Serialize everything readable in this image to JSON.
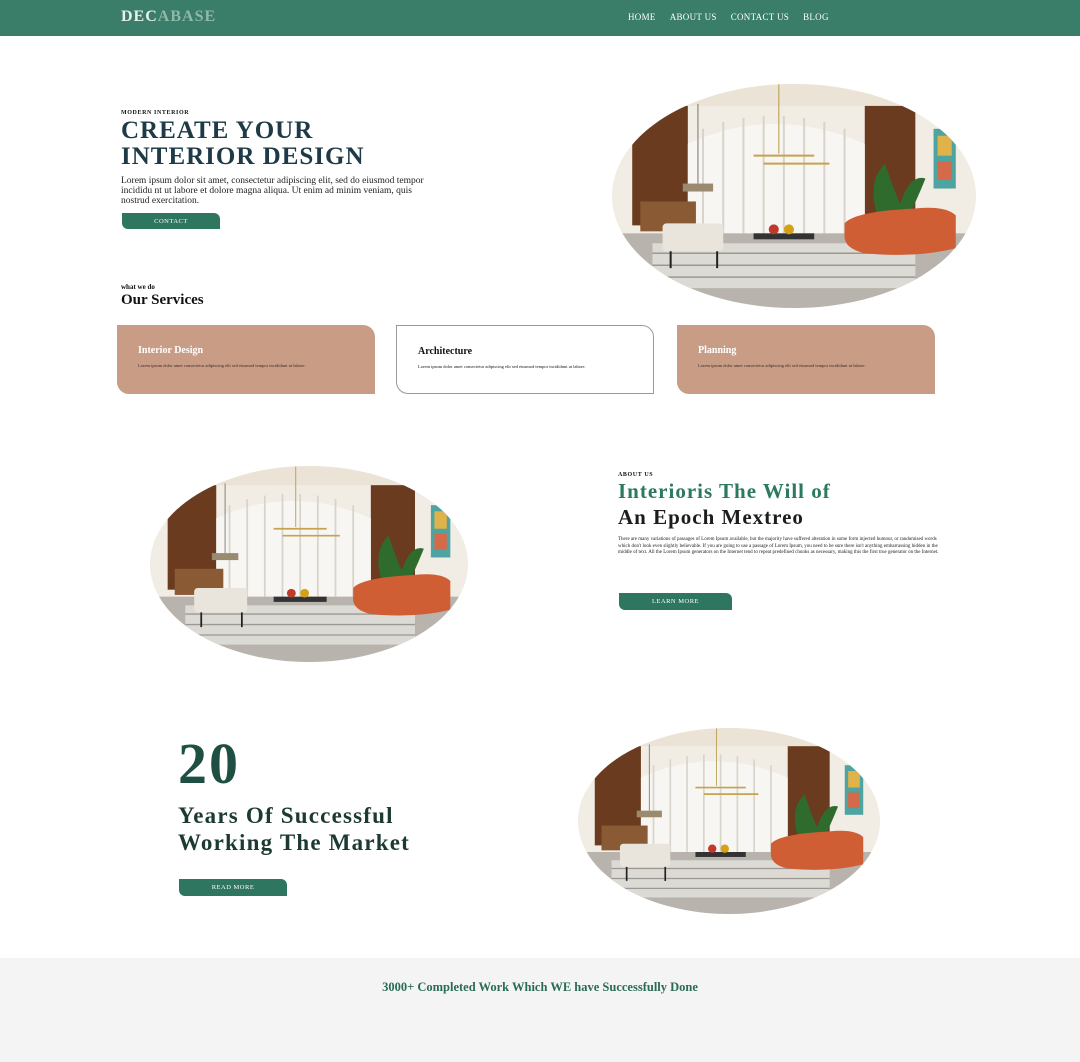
{
  "nav": {
    "logo_a": "DEC",
    "logo_b": "ABASE",
    "items": [
      "HOME",
      "ABOUT US",
      "CONTACT US",
      "BLOG"
    ]
  },
  "hero": {
    "eyebrow": "MODERN INTERIOR",
    "title_line1": "CREATE YOUR",
    "title_line2": "INTERIOR DESIGN",
    "text": "Lorem ipsum dolor sit amet, consectetur adipiscing elit, sed do eiusmod tempor incididu nt ut labore et dolore magna aliqua. Ut enim ad minim veniam, quis nostrud exercitation.",
    "button": "CONTACT"
  },
  "services": {
    "label": "what we do",
    "title": "Our Services",
    "cards": [
      {
        "title": "Interior Design",
        "text": "Lorem ipsum dolor amet consectetur adipiscing elit sed eiusmod tempor incididunt ut labore."
      },
      {
        "title": "Architecture",
        "text": "Lorem ipsum dolor amet consectetur adipiscing elit sed eiusmod tempor incididunt ut labore."
      },
      {
        "title": "Planning",
        "text": "Lorem ipsum dolor amet consectetur adipiscing elit sed eiusmod tempor incididunt ut labore."
      }
    ]
  },
  "about": {
    "eyebrow": "ABOUT US",
    "title_line1": "Interioris The Will of",
    "title_line2": "An Epoch Mextreo",
    "text": "There are many variations of passages of Lorem Ipsum available, but the majority have suffered alteration in some form injected humour, or randomised words which don't look even slightly believable. If you are going to use a passage of Lorem Ipsum, you need to be sure there isn't anything embarrassing hidden in the middle of text. All the Lorem Ipsum generators on the Internet tend to repeat predefined chunks as necessary, making this the first true generator on the Internet.",
    "button": "LEARN MORE"
  },
  "years": {
    "number": "20",
    "title_line1": "Years Of Successful",
    "title_line2": "Working The Market",
    "button": "READ MORE"
  },
  "band": {
    "text": "3000+ Completed Work Which WE have Successfully Done"
  },
  "colors": {
    "nav": "#3a7d68",
    "accent": "#2f7661",
    "card_fill": "#c99c86",
    "heading_dark": "#1d3a46"
  }
}
